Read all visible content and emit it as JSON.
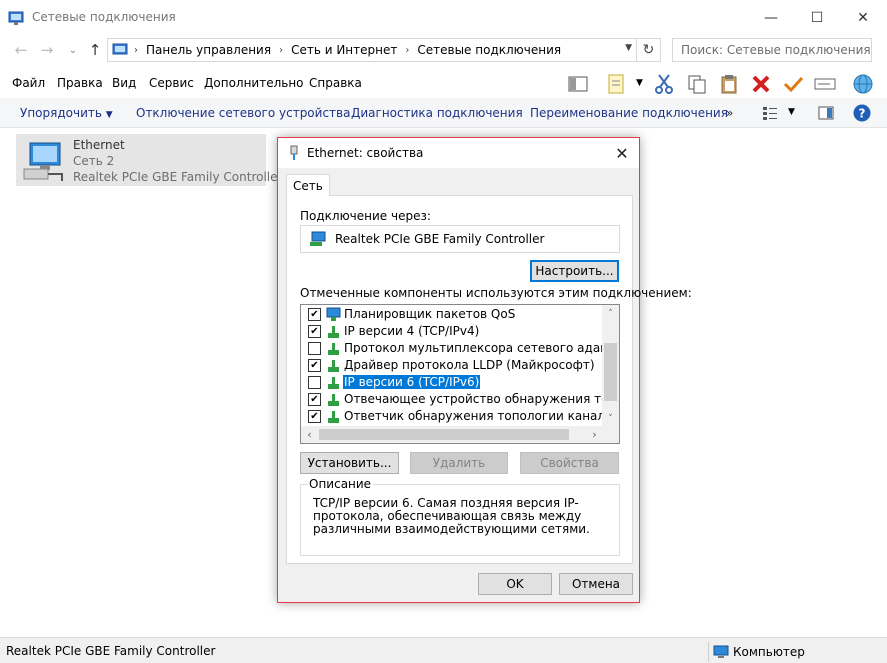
{
  "window": {
    "title": "Сетевые подключения",
    "controls": {
      "minimize": "—",
      "maximize": "☐",
      "close": "✕"
    }
  },
  "address": {
    "breadcrumbs": [
      "Панель управления",
      "Сеть и Интернет",
      "Сетевые подключения"
    ],
    "search_placeholder": "Поиск: Сетевые подключения"
  },
  "menu": [
    "Файл",
    "Правка",
    "Вид",
    "Сервис",
    "Дополнительно",
    "Справка"
  ],
  "toolbar_icons": [
    "pane-icon",
    "properties-icon",
    "cut-icon",
    "copy-icon",
    "paste-icon",
    "delete-icon",
    "checkmark-icon",
    "rename-icon",
    "globe-icon"
  ],
  "commandbar": {
    "organize": "Упорядочить",
    "disable": "Отключение сетевого устройства",
    "diagnose": "Диагностика подключения",
    "rename": "Переименование подключения",
    "more": "»"
  },
  "connection": {
    "name": "Ethernet",
    "network": "Сеть  2",
    "adapter": "Realtek PCIe GBE Family Controller"
  },
  "status": {
    "selection": "Realtek PCIe GBE Family Controller",
    "zone": "Компьютер"
  },
  "dialog": {
    "title": "Ethernet: свойства",
    "tab": "Сеть",
    "connect_using_label": "Подключение через:",
    "adapter": "Realtek PCIe GBE Family Controller",
    "configure_button": "Настроить...",
    "components_label": "Отмеченные компоненты используются этим подключением:",
    "components": [
      {
        "label": "Планировщик пакетов QoS",
        "checked": true,
        "icon": "qos-icon",
        "selected": false
      },
      {
        "label": "IP версии 4 (TCP/IPv4)",
        "checked": true,
        "icon": "protocol-icon",
        "selected": false
      },
      {
        "label": "Протокол мультиплексора сетевого адаптера (Майк",
        "checked": false,
        "icon": "protocol-icon",
        "selected": false
      },
      {
        "label": "Драйвер протокола LLDP (Майкрософт)",
        "checked": true,
        "icon": "protocol-icon",
        "selected": false
      },
      {
        "label": "IP версии 6 (TCP/IPv6)",
        "checked": false,
        "icon": "protocol-icon",
        "selected": true
      },
      {
        "label": "Отвечающее устройство обнаружения топологии к",
        "checked": true,
        "icon": "protocol-icon",
        "selected": false
      },
      {
        "label": "Ответчик обнаружения топологии канального уров",
        "checked": true,
        "icon": "protocol-icon",
        "selected": false
      }
    ],
    "install_button": "Установить...",
    "uninstall_button": "Удалить",
    "properties_button": "Свойства",
    "description_label": "Описание",
    "description": "TCP/IP версии 6. Самая поздняя версия IP-протокола, обеспечивающая связь между различными взаимодействующими сетями.",
    "ok_button": "OK",
    "cancel_button": "Отмена"
  },
  "colors": {
    "accent": "#0078d7",
    "dialog_border": "#e6394a",
    "commandbar_text": "#1e3287",
    "selection_highlight": "#e5e5e5"
  }
}
